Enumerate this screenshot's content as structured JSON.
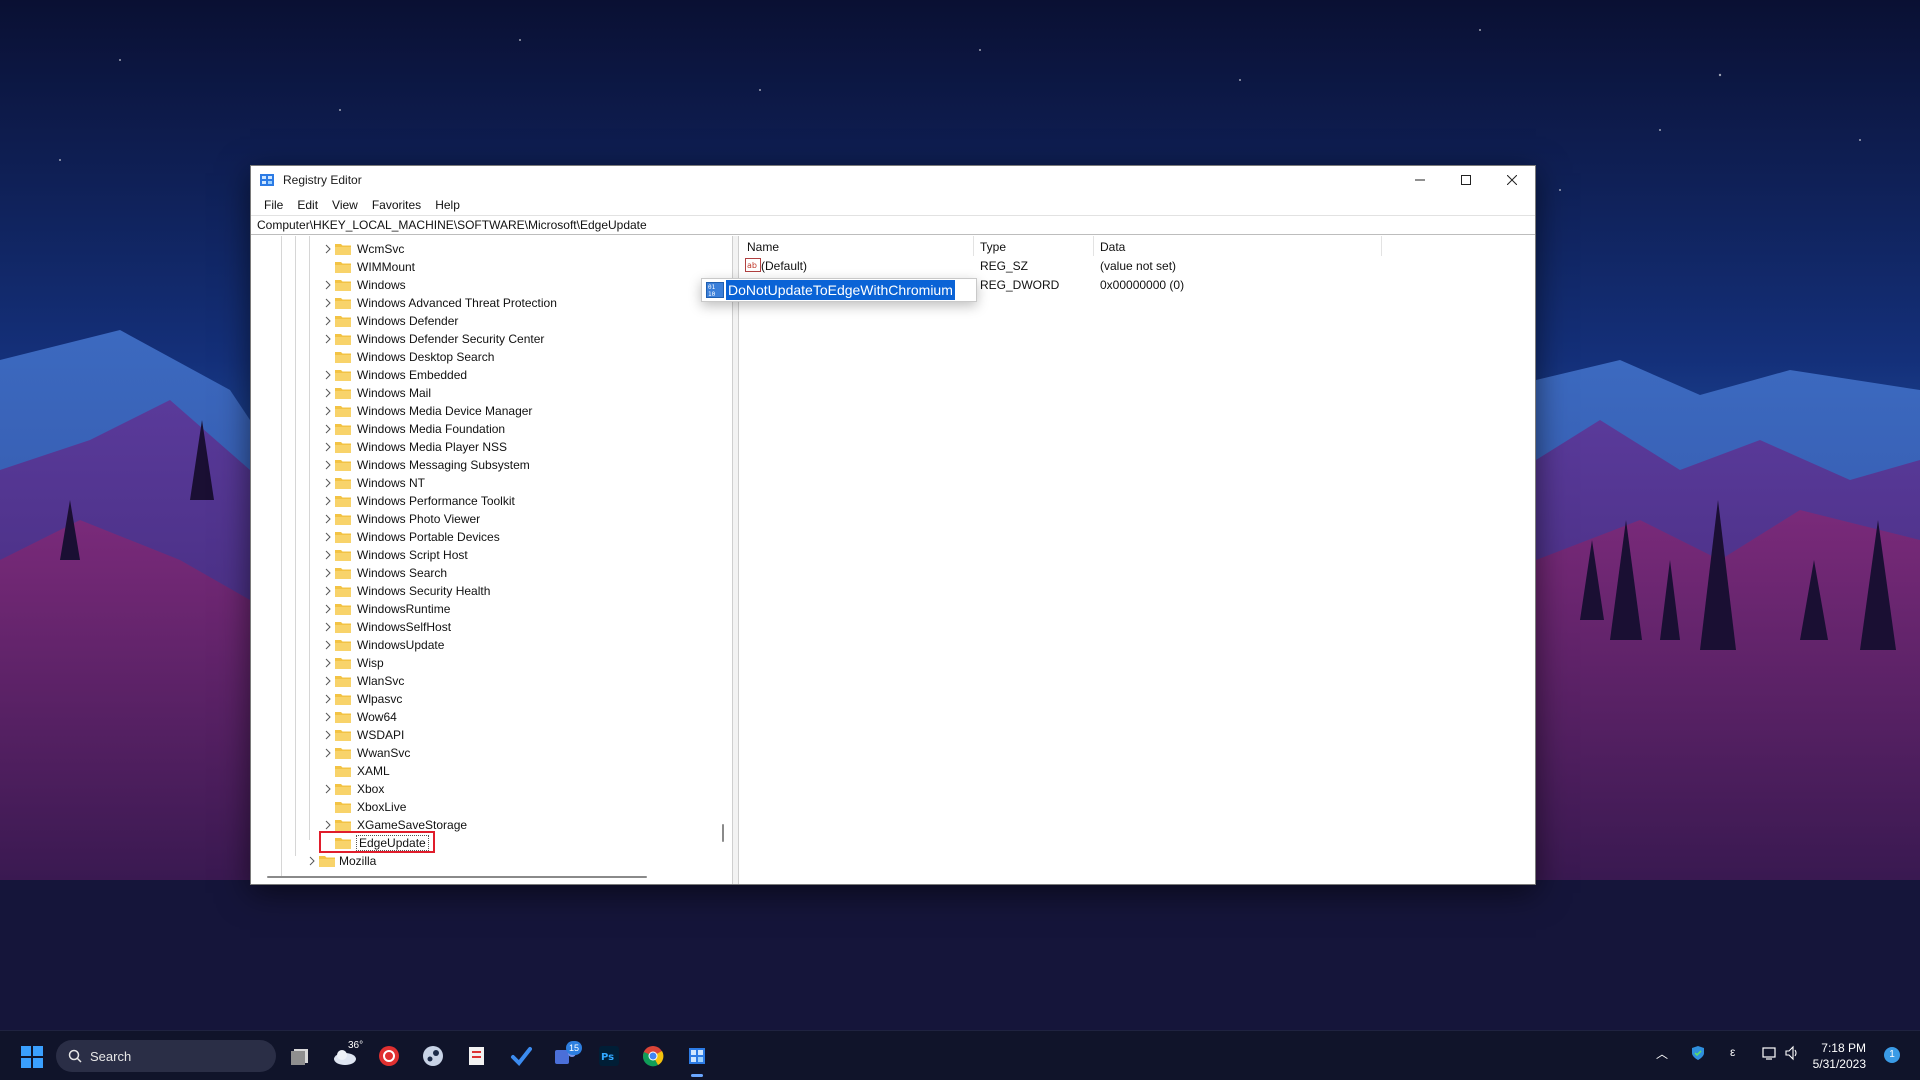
{
  "window": {
    "title": "Registry Editor",
    "minimize": "minimize",
    "maximize": "maximize",
    "close": "close"
  },
  "menu": [
    "File",
    "Edit",
    "View",
    "Favorites",
    "Help"
  ],
  "address": "Computer\\HKEY_LOCAL_MACHINE\\SOFTWARE\\Microsoft\\EdgeUpdate",
  "tree": {
    "items": [
      {
        "label": "WcmSvc",
        "expandable": true
      },
      {
        "label": "WIMMount",
        "expandable": false
      },
      {
        "label": "Windows",
        "expandable": true
      },
      {
        "label": "Windows Advanced Threat Protection",
        "expandable": true
      },
      {
        "label": "Windows Defender",
        "expandable": true
      },
      {
        "label": "Windows Defender Security Center",
        "expandable": true
      },
      {
        "label": "Windows Desktop Search",
        "expandable": false
      },
      {
        "label": "Windows Embedded",
        "expandable": true
      },
      {
        "label": "Windows Mail",
        "expandable": true
      },
      {
        "label": "Windows Media Device Manager",
        "expandable": true
      },
      {
        "label": "Windows Media Foundation",
        "expandable": true
      },
      {
        "label": "Windows Media Player NSS",
        "expandable": true
      },
      {
        "label": "Windows Messaging Subsystem",
        "expandable": true
      },
      {
        "label": "Windows NT",
        "expandable": true
      },
      {
        "label": "Windows Performance Toolkit",
        "expandable": true
      },
      {
        "label": "Windows Photo Viewer",
        "expandable": true
      },
      {
        "label": "Windows Portable Devices",
        "expandable": true
      },
      {
        "label": "Windows Script Host",
        "expandable": true
      },
      {
        "label": "Windows Search",
        "expandable": true
      },
      {
        "label": "Windows Security Health",
        "expandable": true
      },
      {
        "label": "WindowsRuntime",
        "expandable": true
      },
      {
        "label": "WindowsSelfHost",
        "expandable": true
      },
      {
        "label": "WindowsUpdate",
        "expandable": true
      },
      {
        "label": "Wisp",
        "expandable": true
      },
      {
        "label": "WlanSvc",
        "expandable": true
      },
      {
        "label": "Wlpasvc",
        "expandable": true
      },
      {
        "label": "Wow64",
        "expandable": true
      },
      {
        "label": "WSDAPI",
        "expandable": true
      },
      {
        "label": "WwanSvc",
        "expandable": true
      },
      {
        "label": "XAML",
        "expandable": false
      },
      {
        "label": "Xbox",
        "expandable": true
      },
      {
        "label": "XboxLive",
        "expandable": false
      },
      {
        "label": "XGameSaveStorage",
        "expandable": true
      },
      {
        "label": "EdgeUpdate",
        "expandable": false,
        "selected": true
      },
      {
        "label": "Mozilla",
        "expandable": true,
        "level": "parent"
      }
    ]
  },
  "values": {
    "columns": [
      "Name",
      "Type",
      "Data"
    ],
    "rows": [
      {
        "name": "(Default)",
        "type": "REG_SZ",
        "data": "(value not set)",
        "icon": "string-value-icon"
      },
      {
        "name": "DoNotUpdateToEdgeWithChromium",
        "type": "REG_DWORD",
        "data": "0x00000000 (0)",
        "icon": "dword-value-icon",
        "renaming": true
      }
    ]
  },
  "taskbar": {
    "search_label": "Search",
    "weather_temp": "36°",
    "badge_count": "15",
    "tray_lang": "ε",
    "time": "7:18 PM",
    "date": "5/31/2023",
    "notification_count": "1",
    "apps": [
      "task-view-icon",
      "weather-icon",
      "app-red-icon",
      "steam-icon",
      "snipping-icon",
      "todo-icon",
      "teams-icon",
      "photoshop-icon",
      "chrome-icon",
      "registry-editor-icon"
    ]
  },
  "colors": {
    "selection": "#0a63d6",
    "highlight_border": "#e01d2b",
    "folder": "#f3c344"
  }
}
